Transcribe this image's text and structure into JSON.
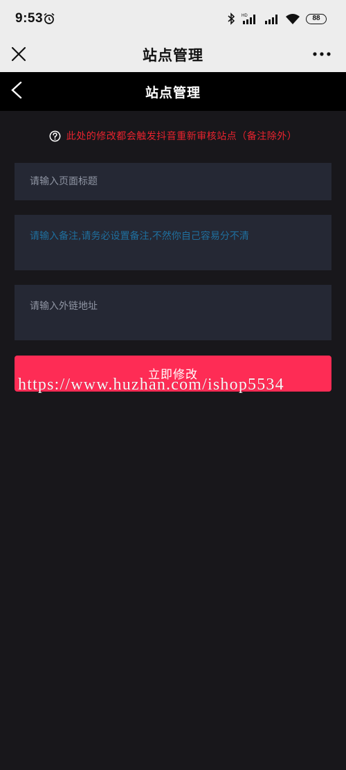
{
  "status_bar": {
    "time": "9:53",
    "battery": "88",
    "icons": [
      "alarm-icon",
      "bluetooth-icon",
      "hd-signal-icon",
      "signal-icon",
      "wifi-icon",
      "battery-icon"
    ]
  },
  "app_bar": {
    "title": "站点管理",
    "close_icon": "close-icon",
    "more_icon": "more-icon"
  },
  "header": {
    "title": "站点管理",
    "back_icon": "chevron-left-icon"
  },
  "notice": {
    "text": "此处的修改都会触发抖音重新审核站点（备注除外）",
    "icon": "question-circle-icon"
  },
  "form": {
    "title_placeholder": "请输入页面标题",
    "title_value": "",
    "remark_placeholder": "请输入备注,请务必设置备注,不然你自己容易分不清",
    "remark_value": "",
    "link_placeholder": "请输入外链地址",
    "link_value": "",
    "submit_label": "立即修改"
  },
  "watermark": "https://www.huzhan.com/ishop5534",
  "colors": {
    "background": "#18171b",
    "field": "#252834",
    "accent": "#fe2c55",
    "notice": "#e8232e",
    "remark_placeholder": "#1f6f9e"
  }
}
